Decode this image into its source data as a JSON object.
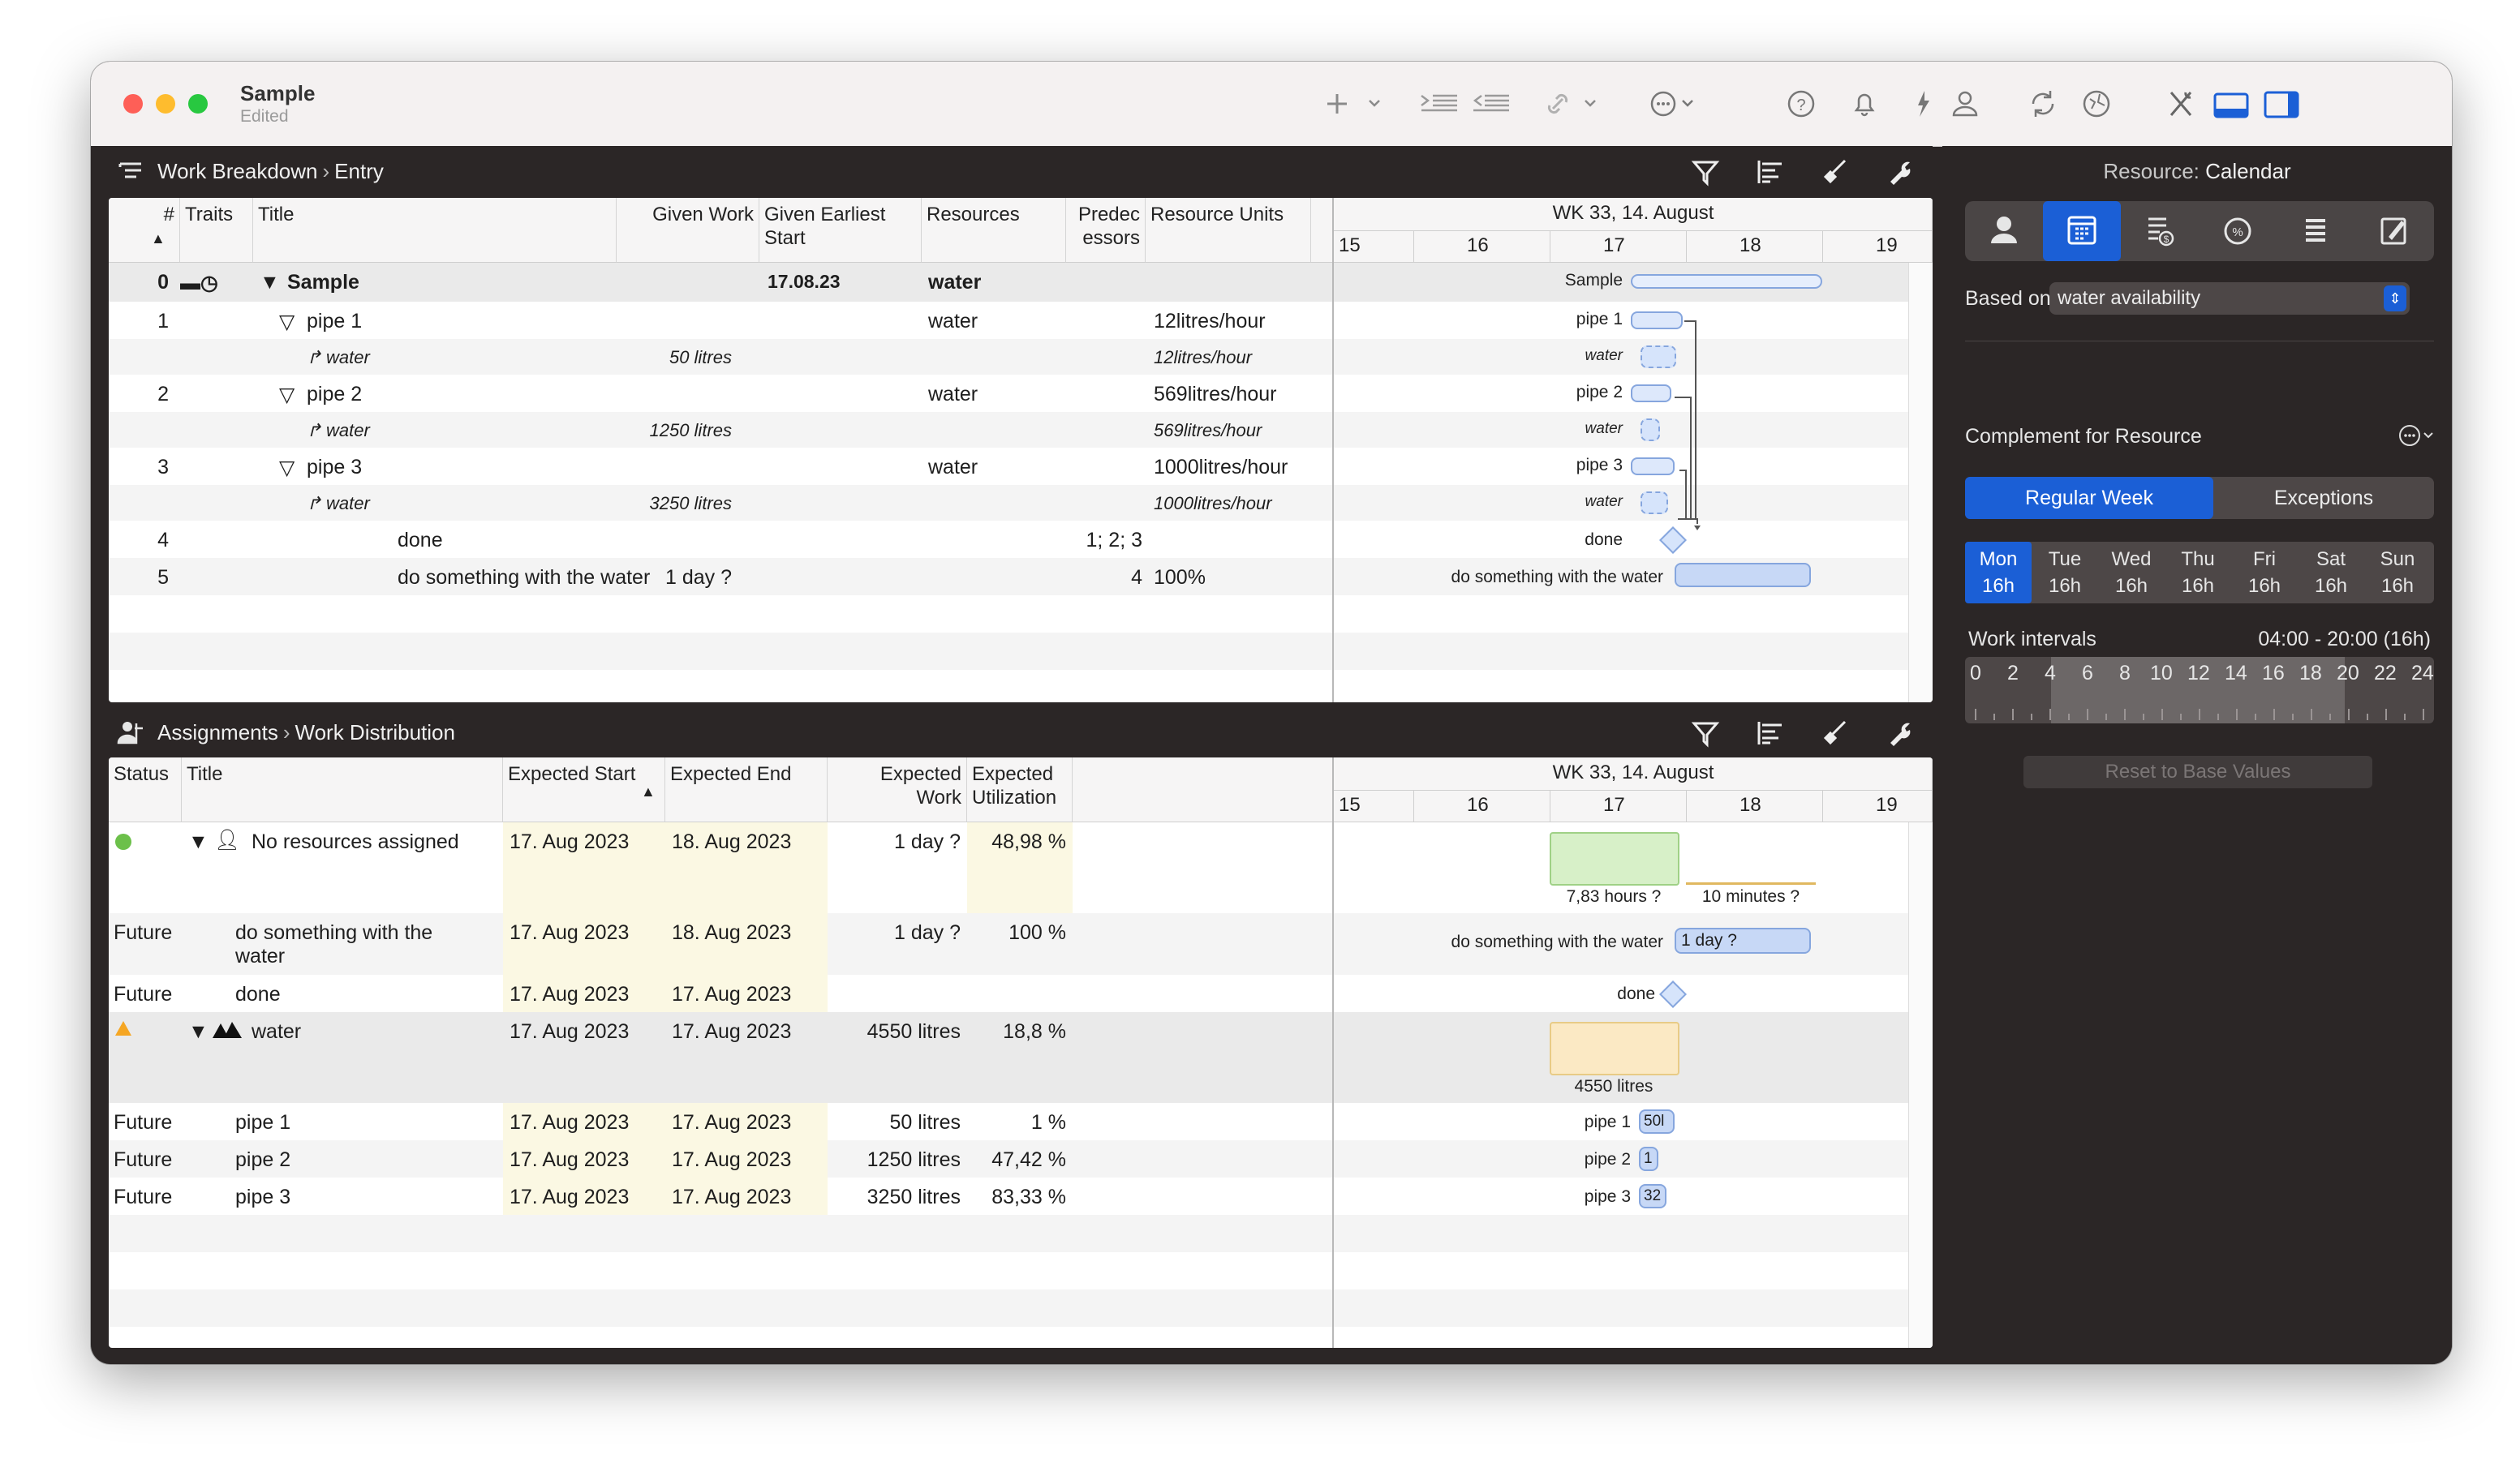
{
  "window": {
    "title": "Sample",
    "subtitle": "Edited"
  },
  "top_pane": {
    "breadcrumb": [
      "Work Breakdown",
      "Entry"
    ],
    "columns": {
      "num": "#",
      "traits": "Traits",
      "title": "Title",
      "given_work": "Given Work",
      "given_earliest_start": "Given Earliest Start",
      "resources": "Resources",
      "predecessors": "Predec essors",
      "resource_units": "Resource Units"
    },
    "gantt": {
      "week": "WK 33, 14. August",
      "days": [
        "15",
        "16",
        "17",
        "18",
        "19"
      ]
    },
    "rows": [
      {
        "num": "0",
        "title": "Sample",
        "given_work": "",
        "start": "17.08.23",
        "resources": "water",
        "pred": "",
        "units": "",
        "gantt_label": "Sample"
      },
      {
        "num": "1",
        "title": "pipe 1",
        "given_work": "",
        "start": "",
        "resources": "water",
        "pred": "",
        "units": "12litres/hour",
        "gantt_label": "pipe 1"
      },
      {
        "num": "",
        "title": "water",
        "given_work": "50 litres",
        "start": "",
        "resources": "",
        "pred": "",
        "units": "12litres/hour",
        "gantt_label": "water"
      },
      {
        "num": "2",
        "title": "pipe 2",
        "given_work": "",
        "start": "",
        "resources": "water",
        "pred": "",
        "units": "569litres/hour",
        "gantt_label": "pipe 2"
      },
      {
        "num": "",
        "title": "water",
        "given_work": "1250 litres",
        "start": "",
        "resources": "",
        "pred": "",
        "units": "569litres/hour",
        "gantt_label": "water"
      },
      {
        "num": "3",
        "title": "pipe 3",
        "given_work": "",
        "start": "",
        "resources": "water",
        "pred": "",
        "units": "1000litres/hour",
        "gantt_label": "pipe 3"
      },
      {
        "num": "",
        "title": "water",
        "given_work": "3250 litres",
        "start": "",
        "resources": "",
        "pred": "",
        "units": "1000litres/hour",
        "gantt_label": "water"
      },
      {
        "num": "4",
        "title": "done",
        "given_work": "",
        "start": "",
        "resources": "",
        "pred": "1; 2; 3",
        "units": "",
        "gantt_label": "done"
      },
      {
        "num": "5",
        "title": "do something with the water",
        "given_work": "1 day ?",
        "start": "",
        "resources": "",
        "pred": "4",
        "units": "100%",
        "gantt_label": "do something with the water"
      }
    ]
  },
  "bottom_pane": {
    "breadcrumb": [
      "Assignments",
      "Work Distribution"
    ],
    "columns": {
      "status": "Status",
      "title": "Title",
      "expected_start": "Expected Start",
      "expected_end": "Expected End",
      "expected_work": "Expected Work",
      "expected_utilization": "Expected Utilization"
    },
    "gantt": {
      "week": "WK 33, 14. August",
      "days": [
        "15",
        "16",
        "17",
        "18",
        "19"
      ]
    },
    "rows": [
      {
        "status": "",
        "title": "No resources assigned",
        "start": "17. Aug 2023",
        "end": "18. Aug 2023",
        "work": "1 day ?",
        "util": "48,98 %"
      },
      {
        "status": "Future",
        "title": "do something with the water",
        "start": "17. Aug 2023",
        "end": "18. Aug 2023",
        "work": "1 day ?",
        "util": "100 %"
      },
      {
        "status": "Future",
        "title": "done",
        "start": "17. Aug 2023",
        "end": "17. Aug 2023",
        "work": "",
        "util": ""
      },
      {
        "status": "",
        "title": "water",
        "start": "17. Aug 2023",
        "end": "17. Aug 2023",
        "work": "4550 litres",
        "util": "18,8 %"
      },
      {
        "status": "Future",
        "title": "pipe 1",
        "start": "17. Aug 2023",
        "end": "17. Aug 2023",
        "work": "50 litres",
        "util": "1 %"
      },
      {
        "status": "Future",
        "title": "pipe 2",
        "start": "17. Aug 2023",
        "end": "17. Aug 2023",
        "work": "1250 litres",
        "util": "47,42 %"
      },
      {
        "status": "Future",
        "title": "pipe 3",
        "start": "17. Aug 2023",
        "end": "17. Aug 2023",
        "work": "3250 litres",
        "util": "83,33 %"
      }
    ],
    "gantt_labels": {
      "hours": "7,83 hours ?",
      "minutes": "10 minutes ?",
      "task": "do something with the water",
      "task_bar": "1 day ?",
      "done": "done",
      "water_total": "4550 litres",
      "pipe1": "pipe 1",
      "pipe1_bar": "50l",
      "pipe2": "pipe 2",
      "pipe2_bar": "1",
      "pipe3": "pipe 3",
      "pipe3_bar": "32"
    }
  },
  "sidebar": {
    "title_prefix": "Resource:",
    "title_value": "Calendar",
    "based_on_label": "Based on",
    "based_on_value": "water availability",
    "complement_label": "Complement for Resource",
    "seg_regular": "Regular Week",
    "seg_exceptions": "Exceptions",
    "days": [
      {
        "name": "Mon",
        "hours": "16h"
      },
      {
        "name": "Tue",
        "hours": "16h"
      },
      {
        "name": "Wed",
        "hours": "16h"
      },
      {
        "name": "Thu",
        "hours": "16h"
      },
      {
        "name": "Fri",
        "hours": "16h"
      },
      {
        "name": "Sat",
        "hours": "16h"
      },
      {
        "name": "Sun",
        "hours": "16h"
      }
    ],
    "work_intervals_label": "Work intervals",
    "work_intervals_value": "04:00 - 20:00 (16h)",
    "scale": [
      "0",
      "2",
      "4",
      "6",
      "8",
      "10",
      "12",
      "14",
      "16",
      "18",
      "20",
      "22",
      "24"
    ],
    "reset_label": "Reset to Base Values"
  },
  "colors": {
    "accent": "#1b5fd6",
    "dark_bg": "#2b2626",
    "bar_blue": "#c7d8f6",
    "green_bar": "#d7f0c8",
    "yellow_bar": "#fbe9c4"
  }
}
